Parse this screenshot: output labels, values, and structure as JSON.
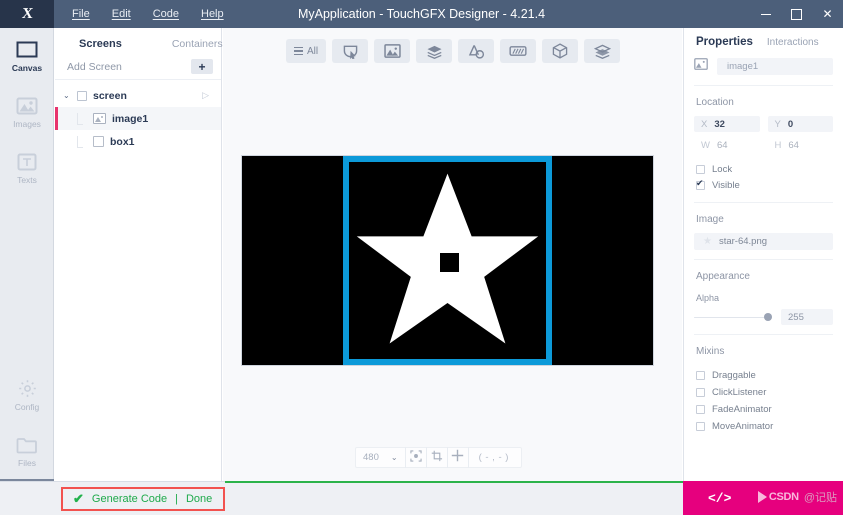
{
  "window": {
    "title": "MyApplication - TouchGFX Designer - 4.21.4",
    "logo_glyph": "X",
    "minimize_label": "",
    "maximize_label": "",
    "close_label": "✕"
  },
  "menubar": {
    "items": [
      {
        "label": "File"
      },
      {
        "label": "Edit"
      },
      {
        "label": "Code"
      },
      {
        "label": "Help"
      }
    ]
  },
  "rail": {
    "items": [
      {
        "label": "Canvas",
        "icon": "canvas-icon",
        "active": true
      },
      {
        "label": "Images",
        "icon": "images-icon",
        "active": false
      },
      {
        "label": "Texts",
        "icon": "texts-icon",
        "active": false
      }
    ],
    "bottom_items": [
      {
        "label": "Config",
        "icon": "gear-icon"
      },
      {
        "label": "Files",
        "icon": "folder-icon"
      }
    ],
    "hamburger": "menu-icon"
  },
  "screens_panel": {
    "tabs": [
      {
        "label": "Screens",
        "active": true
      },
      {
        "label": "Containers",
        "active": false
      }
    ],
    "add_screen_label": "Add Screen",
    "add_button_label": "+",
    "tree": [
      {
        "label": "screen",
        "type": "screen",
        "expanded": true,
        "selected": false,
        "caret": "⌄",
        "play": "▷"
      },
      {
        "label": "image1",
        "type": "image",
        "selected": true
      },
      {
        "label": "box1",
        "type": "box",
        "selected": false
      }
    ]
  },
  "widget_toolbar": {
    "items": [
      {
        "name": "all-widgets-button",
        "label": "All",
        "icon": "list-icon"
      },
      {
        "name": "button-widget",
        "label": "",
        "icon": "button-icon"
      },
      {
        "name": "image-widget",
        "label": "",
        "icon": "image-icon"
      },
      {
        "name": "container-widget",
        "label": "",
        "icon": "layers-icon"
      },
      {
        "name": "shape-widget",
        "label": "",
        "icon": "shape-icon"
      },
      {
        "name": "progress-widget",
        "label": "",
        "icon": "progress-icon"
      },
      {
        "name": "3d-widget",
        "label": "",
        "icon": "cube-icon"
      },
      {
        "name": "misc-widget",
        "label": "",
        "icon": "stack-icon"
      }
    ]
  },
  "canvas": {
    "background_color": "#000000",
    "selection_color": "#0c9ad9",
    "widgets": [
      {
        "name": "image1",
        "asset": "star-64.png",
        "selected": true
      },
      {
        "name": "box1",
        "selected": false
      }
    ]
  },
  "canvas_toolbar": {
    "zoom_value": "480",
    "zoom_caret": "⌄",
    "fit_icon": "fit-to-screen-icon",
    "crop_icon": "crop-icon",
    "move_icon": "move-icon",
    "coordinates": "( - , - )"
  },
  "properties": {
    "tabs": [
      {
        "label": "Properties",
        "active": true
      },
      {
        "label": "Interactions",
        "active": false
      }
    ],
    "name_icon": "image-icon",
    "name_value": "image1",
    "location": {
      "title": "Location",
      "x_key": "X",
      "x_value": "32",
      "y_key": "Y",
      "y_value": "0",
      "w_key": "W",
      "w_value": "64",
      "h_key": "H",
      "h_value": "64",
      "lock_label": "Lock",
      "lock_checked": false,
      "visible_label": "Visible",
      "visible_checked": true
    },
    "image": {
      "title": "Image",
      "asset_icon": "star-icon",
      "asset_value": "star-64.png"
    },
    "appearance": {
      "title": "Appearance",
      "alpha_label": "Alpha",
      "alpha_value": "255"
    },
    "mixins": {
      "title": "Mixins",
      "items": [
        {
          "label": "Draggable",
          "checked": false
        },
        {
          "label": "ClickListener",
          "checked": false
        },
        {
          "label": "FadeAnimator",
          "checked": false
        },
        {
          "label": "MoveAnimator",
          "checked": false
        }
      ]
    }
  },
  "bottombar": {
    "generate_check": "✔",
    "generate_label": "Generate Code",
    "separator": "|",
    "done_label": "Done",
    "code_glyph": "</>",
    "watermark_text": "CSDN",
    "watermark_cn": "@记贴"
  },
  "colors": {
    "titlebar": "#4c5f7a",
    "logo_bg": "#27344a",
    "accent_pink": "#e6007e",
    "selection_blue": "#0c9ad9",
    "success_green": "#1faa4b",
    "alert_red": "#f2524f"
  }
}
